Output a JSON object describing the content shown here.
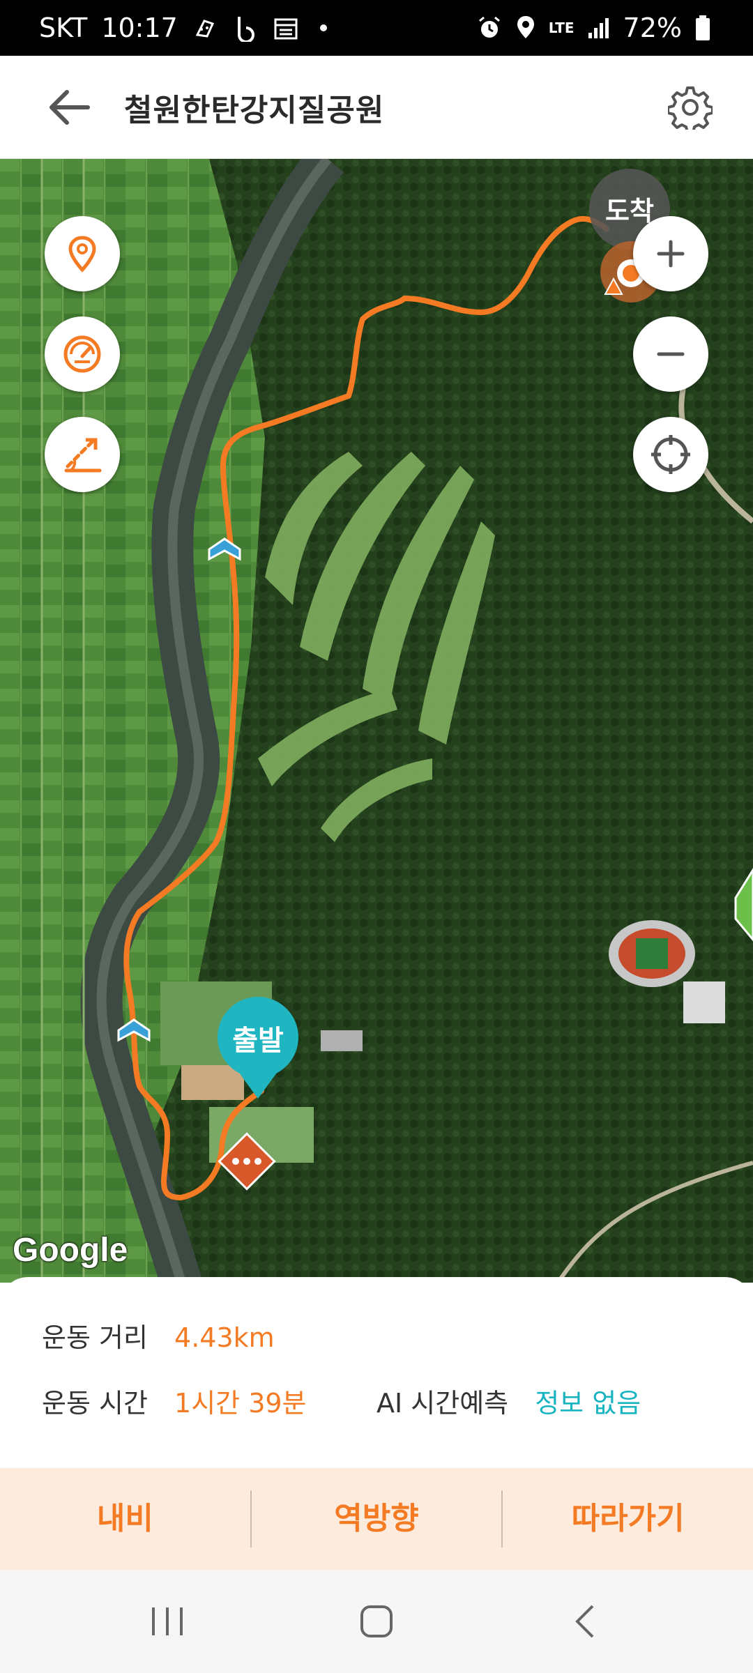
{
  "status_bar": {
    "carrier": "SKT",
    "time": "10:17",
    "network": "LTE",
    "battery": "72%"
  },
  "app_bar": {
    "title": "철원한탄강지질공원",
    "back_icon": "arrow-left-icon",
    "settings_icon": "gear-icon"
  },
  "map": {
    "arrival_label": "도착",
    "start_label": "출발",
    "google_label": "Google",
    "route_color": "#f47b23",
    "left_controls": [
      "location-pin-icon",
      "speedometer-icon",
      "elevation-icon"
    ],
    "right_controls": [
      "zoom-in-icon",
      "zoom-out-icon",
      "crosshair-icon"
    ]
  },
  "info": {
    "distance_label": "운동 거리",
    "distance_value": "4.43km",
    "time_label": "운동 시간",
    "time_value": "1시간 39분",
    "ai_label": "AI 시간예측",
    "ai_value": "정보 없음"
  },
  "actions": {
    "navi": "내비",
    "reverse": "역방향",
    "follow": "따라가기"
  },
  "colors": {
    "accent": "#f47b23",
    "teal": "#19b4c1",
    "action_bg": "#fdebdd"
  }
}
